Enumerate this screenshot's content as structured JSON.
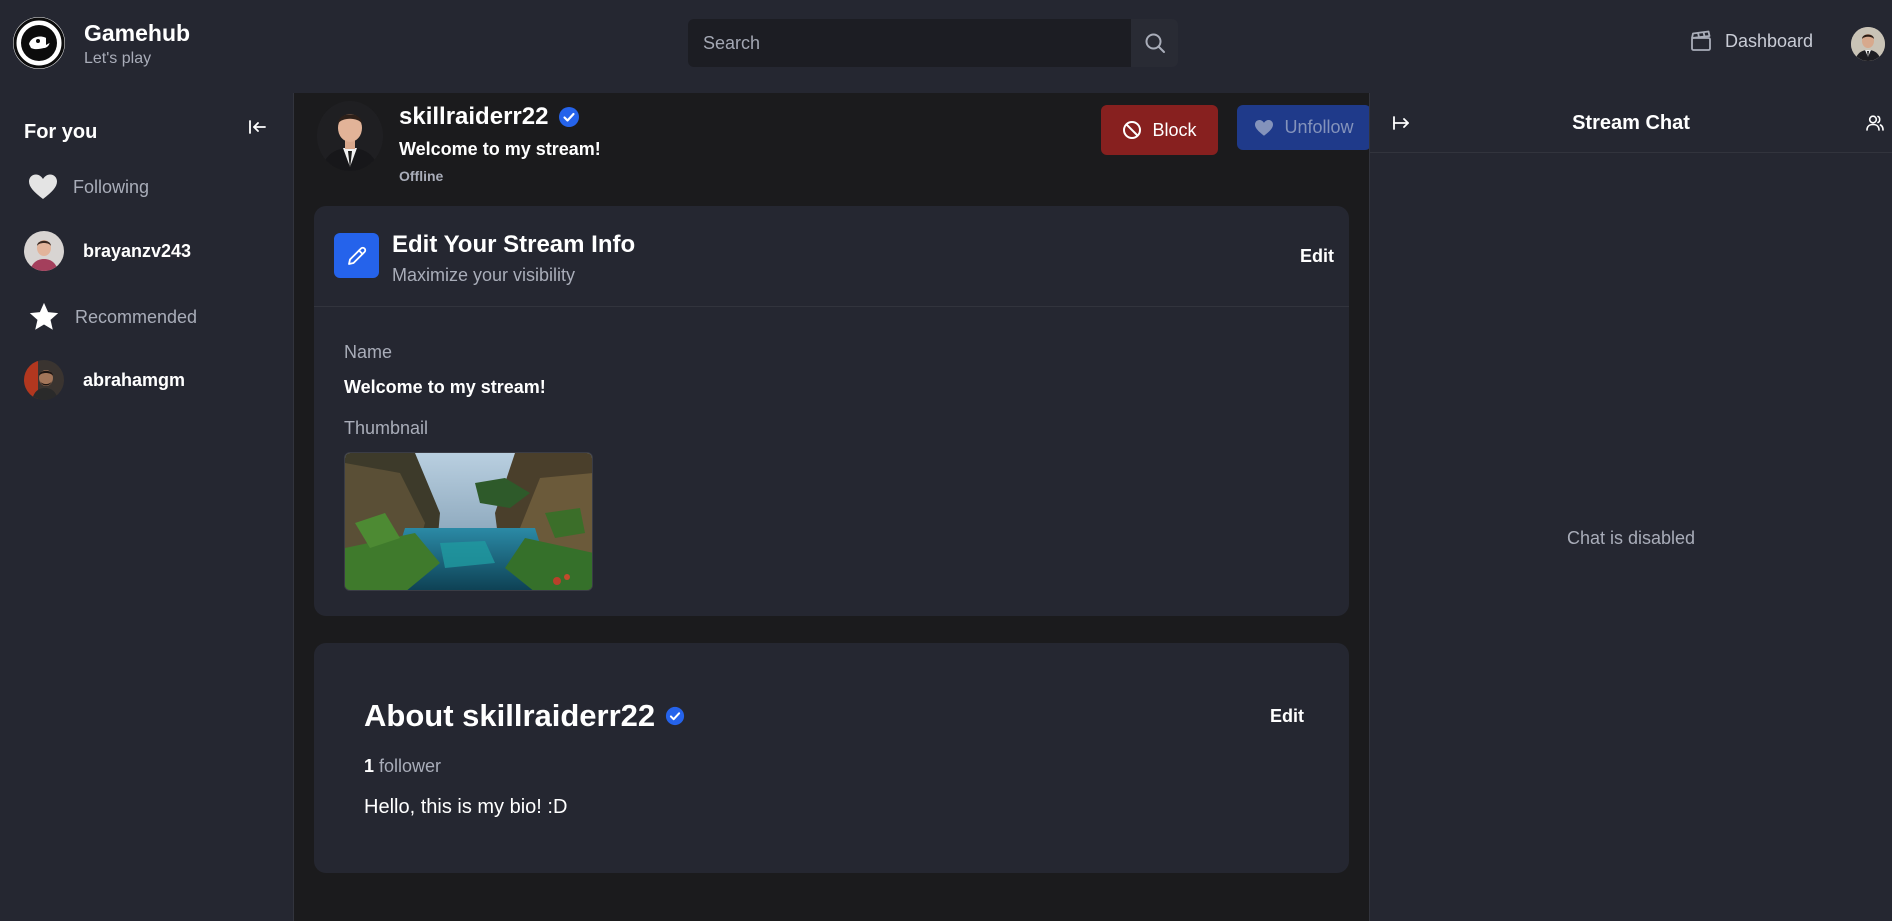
{
  "brand": {
    "title": "Gamehub",
    "subtitle": "Let's play"
  },
  "search": {
    "placeholder": "Search",
    "icon": "search-icon"
  },
  "header": {
    "dashboard_label": "Dashboard",
    "dashboard_icon": "clapperboard-icon"
  },
  "sidebar": {
    "heading": "For you",
    "following_label": "Following",
    "following_users": [
      {
        "name": "brayanzv243"
      }
    ],
    "recommended_label": "Recommended",
    "recommended_users": [
      {
        "name": "abrahamgm"
      }
    ]
  },
  "stream": {
    "host": "skillraiderr22",
    "title": "Welcome to my stream!",
    "status": "Offline",
    "block_label": "Block",
    "unfollow_label": "Unfollow"
  },
  "info_card": {
    "title": "Edit Your Stream Info",
    "subtitle": "Maximize your visibility",
    "edit_label": "Edit",
    "name_label": "Name",
    "name_value": "Welcome to my stream!",
    "thumbnail_label": "Thumbnail"
  },
  "about_card": {
    "title": "About skillraiderr22",
    "edit_label": "Edit",
    "follower_count": "1",
    "follower_word": "follower",
    "bio": "Hello, this is my bio! :D"
  },
  "chat": {
    "title": "Stream Chat",
    "disabled_text": "Chat is disabled"
  },
  "colors": {
    "background": "#1b1b1d",
    "panel": "#252731",
    "accent_blue": "#2563eb",
    "block_red": "#87201f",
    "unfollow_blue": "#1f3a8a",
    "muted_text": "#a9adb9"
  }
}
